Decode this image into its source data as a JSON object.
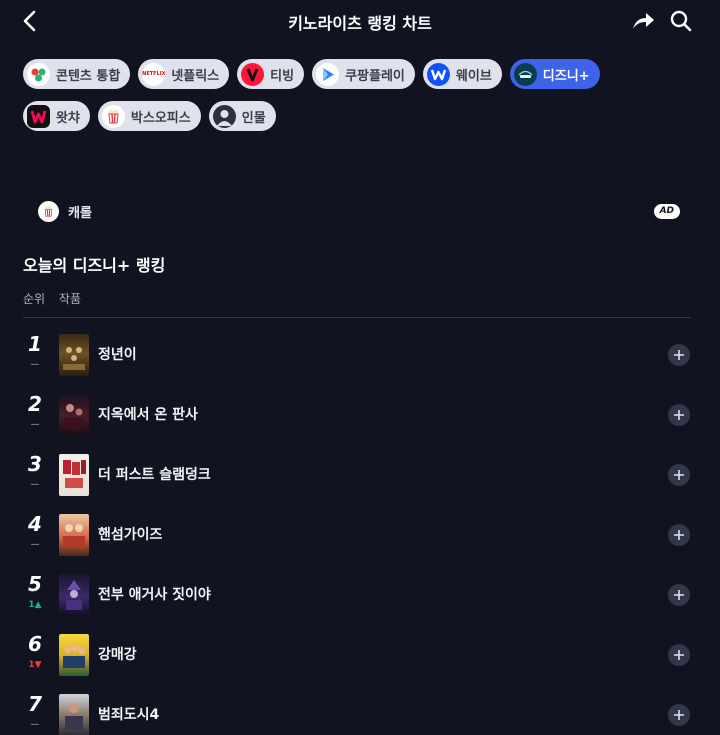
{
  "header": {
    "title": "키노라이츠 랭킹 차트",
    "back_icon": "chevron-left-icon",
    "share_icon": "share-icon",
    "search_icon": "search-icon"
  },
  "chips": [
    {
      "id": "contents",
      "label": "콘텐츠 통합",
      "icon": "contents-icon",
      "active": false
    },
    {
      "id": "netflix",
      "label": "넷플릭스",
      "icon": "netflix-logo",
      "logo_text": "NETFLIX",
      "active": false
    },
    {
      "id": "tving",
      "label": "티빙",
      "icon": "tving-logo",
      "active": false
    },
    {
      "id": "coupang",
      "label": "쿠팡플레이",
      "icon": "coupangplay-logo",
      "active": false
    },
    {
      "id": "wavve",
      "label": "웨이브",
      "icon": "wavve-logo",
      "active": false
    },
    {
      "id": "disney",
      "label": "디즈니+",
      "icon": "disney-logo",
      "active": true
    },
    {
      "id": "watcha",
      "label": "왓챠",
      "icon": "watcha-logo",
      "active": false
    },
    {
      "id": "boxoffice",
      "label": "박스오피스",
      "icon": "popcorn-icon",
      "active": false
    },
    {
      "id": "people",
      "label": "인물",
      "icon": "person-icon",
      "active": false
    }
  ],
  "ad": {
    "name": "캐롤",
    "badge": "AD",
    "icon": "popcorn-icon"
  },
  "section": {
    "title": "오늘의 디즈니+ 랭킹",
    "col_rank": "순위",
    "col_work": "작품"
  },
  "rankings": [
    {
      "rank": "1",
      "change": "—",
      "trend": "same",
      "title": "정년이"
    },
    {
      "rank": "2",
      "change": "—",
      "trend": "same",
      "title": "지옥에서 온 판사"
    },
    {
      "rank": "3",
      "change": "—",
      "trend": "same",
      "title": "더 퍼스트 슬램덩크"
    },
    {
      "rank": "4",
      "change": "—",
      "trend": "same",
      "title": "핸섬가이즈"
    },
    {
      "rank": "5",
      "change": "1▲",
      "trend": "up",
      "title": "전부 애거사 짓이야"
    },
    {
      "rank": "6",
      "change": "1▼",
      "trend": "down",
      "title": "강매강"
    },
    {
      "rank": "7",
      "change": "—",
      "trend": "same",
      "title": "범죄도시4"
    }
  ],
  "colors": {
    "background": "#111420",
    "chip_bg": "#dfe2ea",
    "chip_active": "#3f63e8",
    "up": "#17b47d",
    "down": "#f03b3b"
  }
}
